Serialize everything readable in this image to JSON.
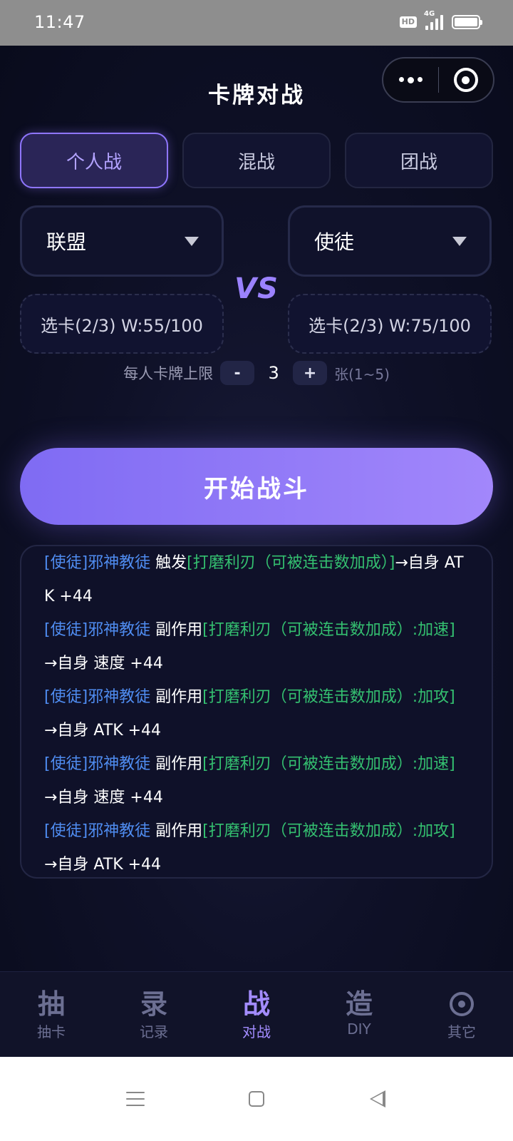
{
  "status_bar": {
    "time": "11:47",
    "hd": "HD",
    "network": "4G"
  },
  "header": {
    "title": "卡牌对战"
  },
  "modes": [
    {
      "label": "个人战",
      "active": true
    },
    {
      "label": "混战",
      "active": false
    },
    {
      "label": "团战",
      "active": false
    }
  ],
  "factions": {
    "left": "联盟",
    "right": "使徒"
  },
  "vs_label": "VS",
  "picks": {
    "left": "选卡(2/3) W:55/100",
    "right": "选卡(2/3) W:75/100"
  },
  "card_limit": {
    "label": "每人卡牌上限",
    "minus": "-",
    "value": "3",
    "plus": "+",
    "unit": "张(1~5)"
  },
  "start_button": "开始战斗",
  "battle_log": [
    {
      "who": "[使徒]邪神教徒",
      "action": " 触发",
      "skill": "[打磨利刃（可被连击数加成）]",
      "result": "→自身 ATK +44"
    },
    {
      "who": "[使徒]邪神教徒",
      "action": " 副作用",
      "skill": "[打磨利刃（可被连击数加成）:加速]",
      "result": "→自身 速度 +44"
    },
    {
      "who": "[使徒]邪神教徒",
      "action": " 副作用",
      "skill": "[打磨利刃（可被连击数加成）:加攻]",
      "result": "→自身 ATK +44"
    },
    {
      "who": "[使徒]邪神教徒",
      "action": " 副作用",
      "skill": "[打磨利刃（可被连击数加成）:加速]",
      "result": "→自身 速度 +44"
    },
    {
      "who": "[使徒]邪神教徒",
      "action": " 副作用",
      "skill": "[打磨利刃（可被连击数加成）:加攻]",
      "result": "→自身 ATK +44"
    }
  ],
  "tabbar": [
    {
      "glyph": "抽",
      "label": "抽卡",
      "active": false
    },
    {
      "glyph": "录",
      "label": "记录",
      "active": false
    },
    {
      "glyph": "战",
      "label": "对战",
      "active": true
    },
    {
      "glyph": "造",
      "label": "DIY",
      "active": false
    },
    {
      "glyph": "",
      "label": "其它",
      "active": false,
      "icon": "gear-icon"
    }
  ],
  "colors": {
    "accent": "#9b82ff",
    "log_name": "#4f8cf0",
    "log_skill": "#34c070",
    "background": "#0b0d20"
  }
}
